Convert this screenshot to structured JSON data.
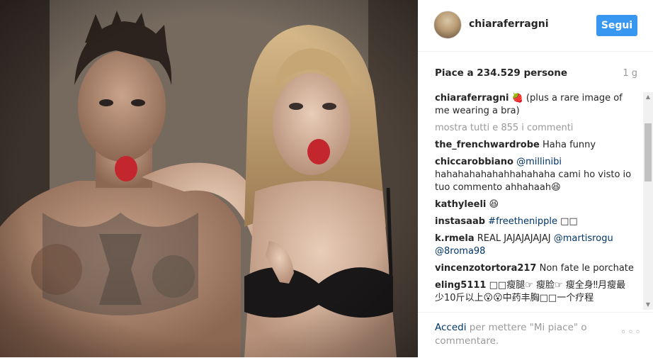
{
  "post": {
    "username": "chiaraferragni",
    "follow_label": "Segui",
    "likes": "Piace a 234.529 persone",
    "age": "1 g"
  },
  "comments": {
    "caption_user": "chiaraferragni",
    "caption_text": "🍓 (plus a rare image of me wearing a bra)",
    "show_all": "mostra tutti e 855 i commenti",
    "items": [
      {
        "user": "the_frenchwardrobe",
        "text": "Haha funny"
      },
      {
        "user": "chiccarobbiano",
        "tag": "@millinibi",
        "text": "hahahahahahahhahahaha cami ho visto io tuo commento ahhahaah😆"
      },
      {
        "user": "kathyleeli",
        "text": "😆"
      },
      {
        "user": "instasaab",
        "tag": "#freethenipple",
        "text": "□□"
      },
      {
        "user": "k.rmela",
        "text": "REAL JAJAJAJAJAJ",
        "tag2": "@martisrogu @8roma98"
      },
      {
        "user": "vincenzotortora217",
        "text": "Non fate le porchate"
      },
      {
        "user": "eling5111",
        "text": "□□瘦腿☞ 瘦脸☞ 瘦全身‼月瘦最少10斤以上😮😮中药丰胸□□一个疗程"
      }
    ]
  },
  "footer": {
    "login_link": "Accedi",
    "login_text": " per mettere \"Mi piace\" o commentare.",
    "more_icon": "◦◦◦"
  },
  "colors": {
    "follow_button": "#3897f0",
    "link": "#003569",
    "muted": "#999999"
  }
}
